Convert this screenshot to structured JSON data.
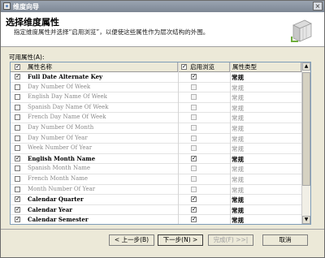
{
  "window": {
    "title": "维度向导",
    "close_glyph": "×"
  },
  "header": {
    "title": "选择维度属性",
    "subtitle": "指定维度属性并选择“启用浏览”，以便使这些属性作为层次结构的外围。"
  },
  "available_label": "可用属性(A):",
  "grid": {
    "columns": {
      "name": "属性名称",
      "browse": "启用浏览",
      "type": "属性类型"
    },
    "rows": [
      {
        "name": "Full Date Alternate Key",
        "checked": true,
        "browse": true,
        "type": "常规"
      },
      {
        "name": "Day Number Of Week",
        "checked": false,
        "browse": false,
        "type": "常规"
      },
      {
        "name": "English Day Name Of Week",
        "checked": false,
        "browse": false,
        "type": "常规"
      },
      {
        "name": "Spanish Day Name Of Week",
        "checked": false,
        "browse": false,
        "type": "常规"
      },
      {
        "name": "French Day Name Of Week",
        "checked": false,
        "browse": false,
        "type": "常规"
      },
      {
        "name": "Day Number Of Month",
        "checked": false,
        "browse": false,
        "type": "常规"
      },
      {
        "name": "Day Number Of Year",
        "checked": false,
        "browse": false,
        "type": "常规"
      },
      {
        "name": "Week Number Of Year",
        "checked": false,
        "browse": false,
        "type": "常规"
      },
      {
        "name": "English Month Name",
        "checked": true,
        "browse": true,
        "type": "常规"
      },
      {
        "name": "Spanish Month Name",
        "checked": false,
        "browse": false,
        "type": "常规"
      },
      {
        "name": "French Month Name",
        "checked": false,
        "browse": false,
        "type": "常规"
      },
      {
        "name": "Month Number Of Year",
        "checked": false,
        "browse": false,
        "type": "常规"
      },
      {
        "name": "Calendar Quarter",
        "checked": true,
        "browse": true,
        "type": "常规"
      },
      {
        "name": "Calendar Year",
        "checked": true,
        "browse": true,
        "type": "常规"
      },
      {
        "name": "Calendar Semester",
        "checked": true,
        "browse": true,
        "type": "常规"
      }
    ]
  },
  "buttons": {
    "back": "< 上一步(B)",
    "next": "下一步(N) >",
    "finish": "完成(F) >>|",
    "cancel": "取消"
  },
  "check_glyph": "✓"
}
